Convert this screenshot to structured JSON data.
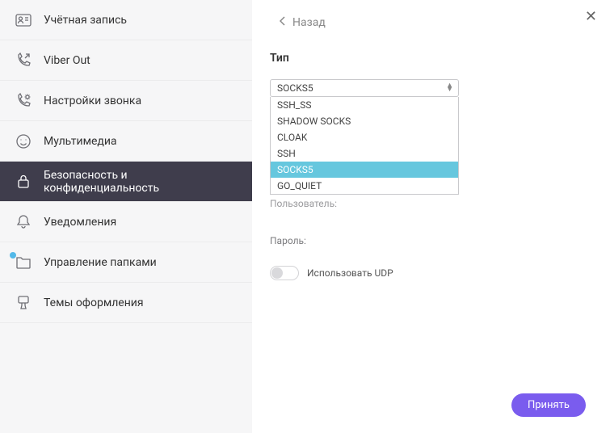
{
  "sidebar": {
    "items": [
      {
        "label": "Учётная запись"
      },
      {
        "label": "Viber Out"
      },
      {
        "label": "Настройки звонка"
      },
      {
        "label": "Мультимедиа"
      },
      {
        "label": "Безопасность и конфиденциальность"
      },
      {
        "label": "Уведомления"
      },
      {
        "label": "Управление папками"
      },
      {
        "label": "Темы оформления"
      }
    ]
  },
  "header": {
    "back": "Назад"
  },
  "form": {
    "type_label": "Тип",
    "selected": "SOCKS5",
    "options": [
      "SSH_SS",
      "SHADOW SOCKS",
      "CLOAK",
      "SSH",
      "SOCKS5",
      "GO_QUIET"
    ],
    "hidden_label": "Пользователь:",
    "password_label": "Пароль:",
    "udp_label": "Использовать UDP"
  },
  "footer": {
    "accept": "Принять"
  },
  "colors": {
    "accent": "#7a5cee",
    "active_bg": "#3f3d4c",
    "select_highlight": "#66c7de",
    "indicator": "#53b9e9"
  }
}
